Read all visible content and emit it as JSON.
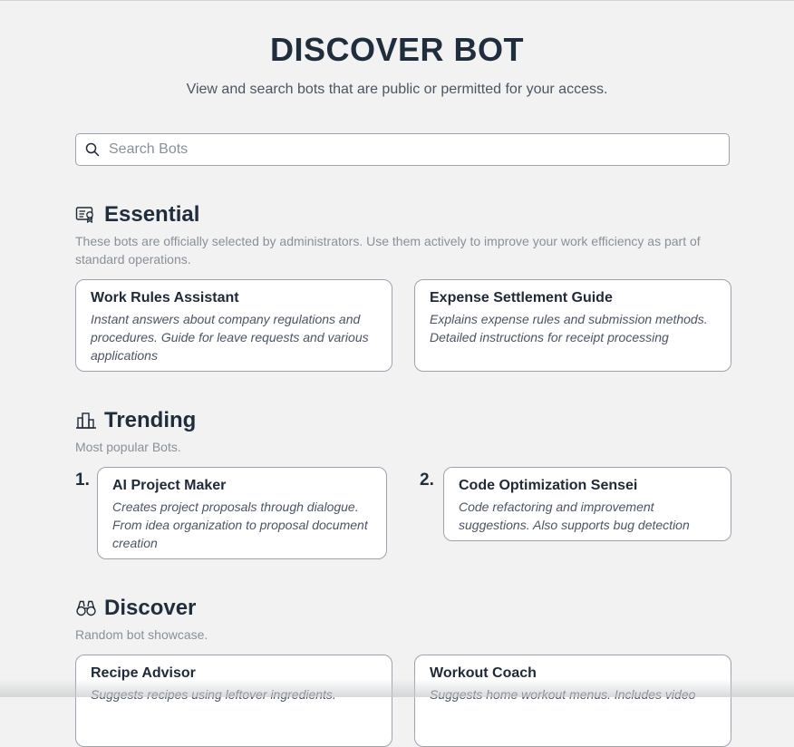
{
  "header": {
    "title": "DISCOVER BOT",
    "subtitle": "View and search bots that are public or permitted for your access."
  },
  "search": {
    "placeholder": "Search Bots",
    "icon": "search-icon"
  },
  "essential": {
    "title": "Essential",
    "icon": "certificate-icon",
    "description": "These bots are officially selected by administrators. Use them actively to improve your work efficiency as part of standard operations.",
    "bots": [
      {
        "name": "Work Rules Assistant",
        "description": "Instant answers about company regulations and procedures. Guide for leave requests and various applications"
      },
      {
        "name": "Expense Settlement Guide",
        "description": "Explains expense rules and submission methods. Detailed instructions for receipt processing"
      }
    ]
  },
  "trending": {
    "title": "Trending",
    "icon": "buildings-icon",
    "description": "Most popular Bots.",
    "bots": [
      {
        "rank": "1.",
        "name": "AI Project Maker",
        "description": "Creates project proposals through dialogue. From idea organization to proposal document creation"
      },
      {
        "rank": "2.",
        "name": "Code Optimization Sensei",
        "description": "Code refactoring and improvement suggestions. Also supports bug detection"
      }
    ]
  },
  "discover": {
    "title": "Discover",
    "icon": "binoculars-icon",
    "description": "Random bot showcase.",
    "bots": [
      {
        "name": "Recipe Advisor",
        "description": "Suggests recipes using leftover ingredients."
      },
      {
        "name": "Workout Coach",
        "description": "Suggests home workout menus. Includes video"
      }
    ]
  }
}
